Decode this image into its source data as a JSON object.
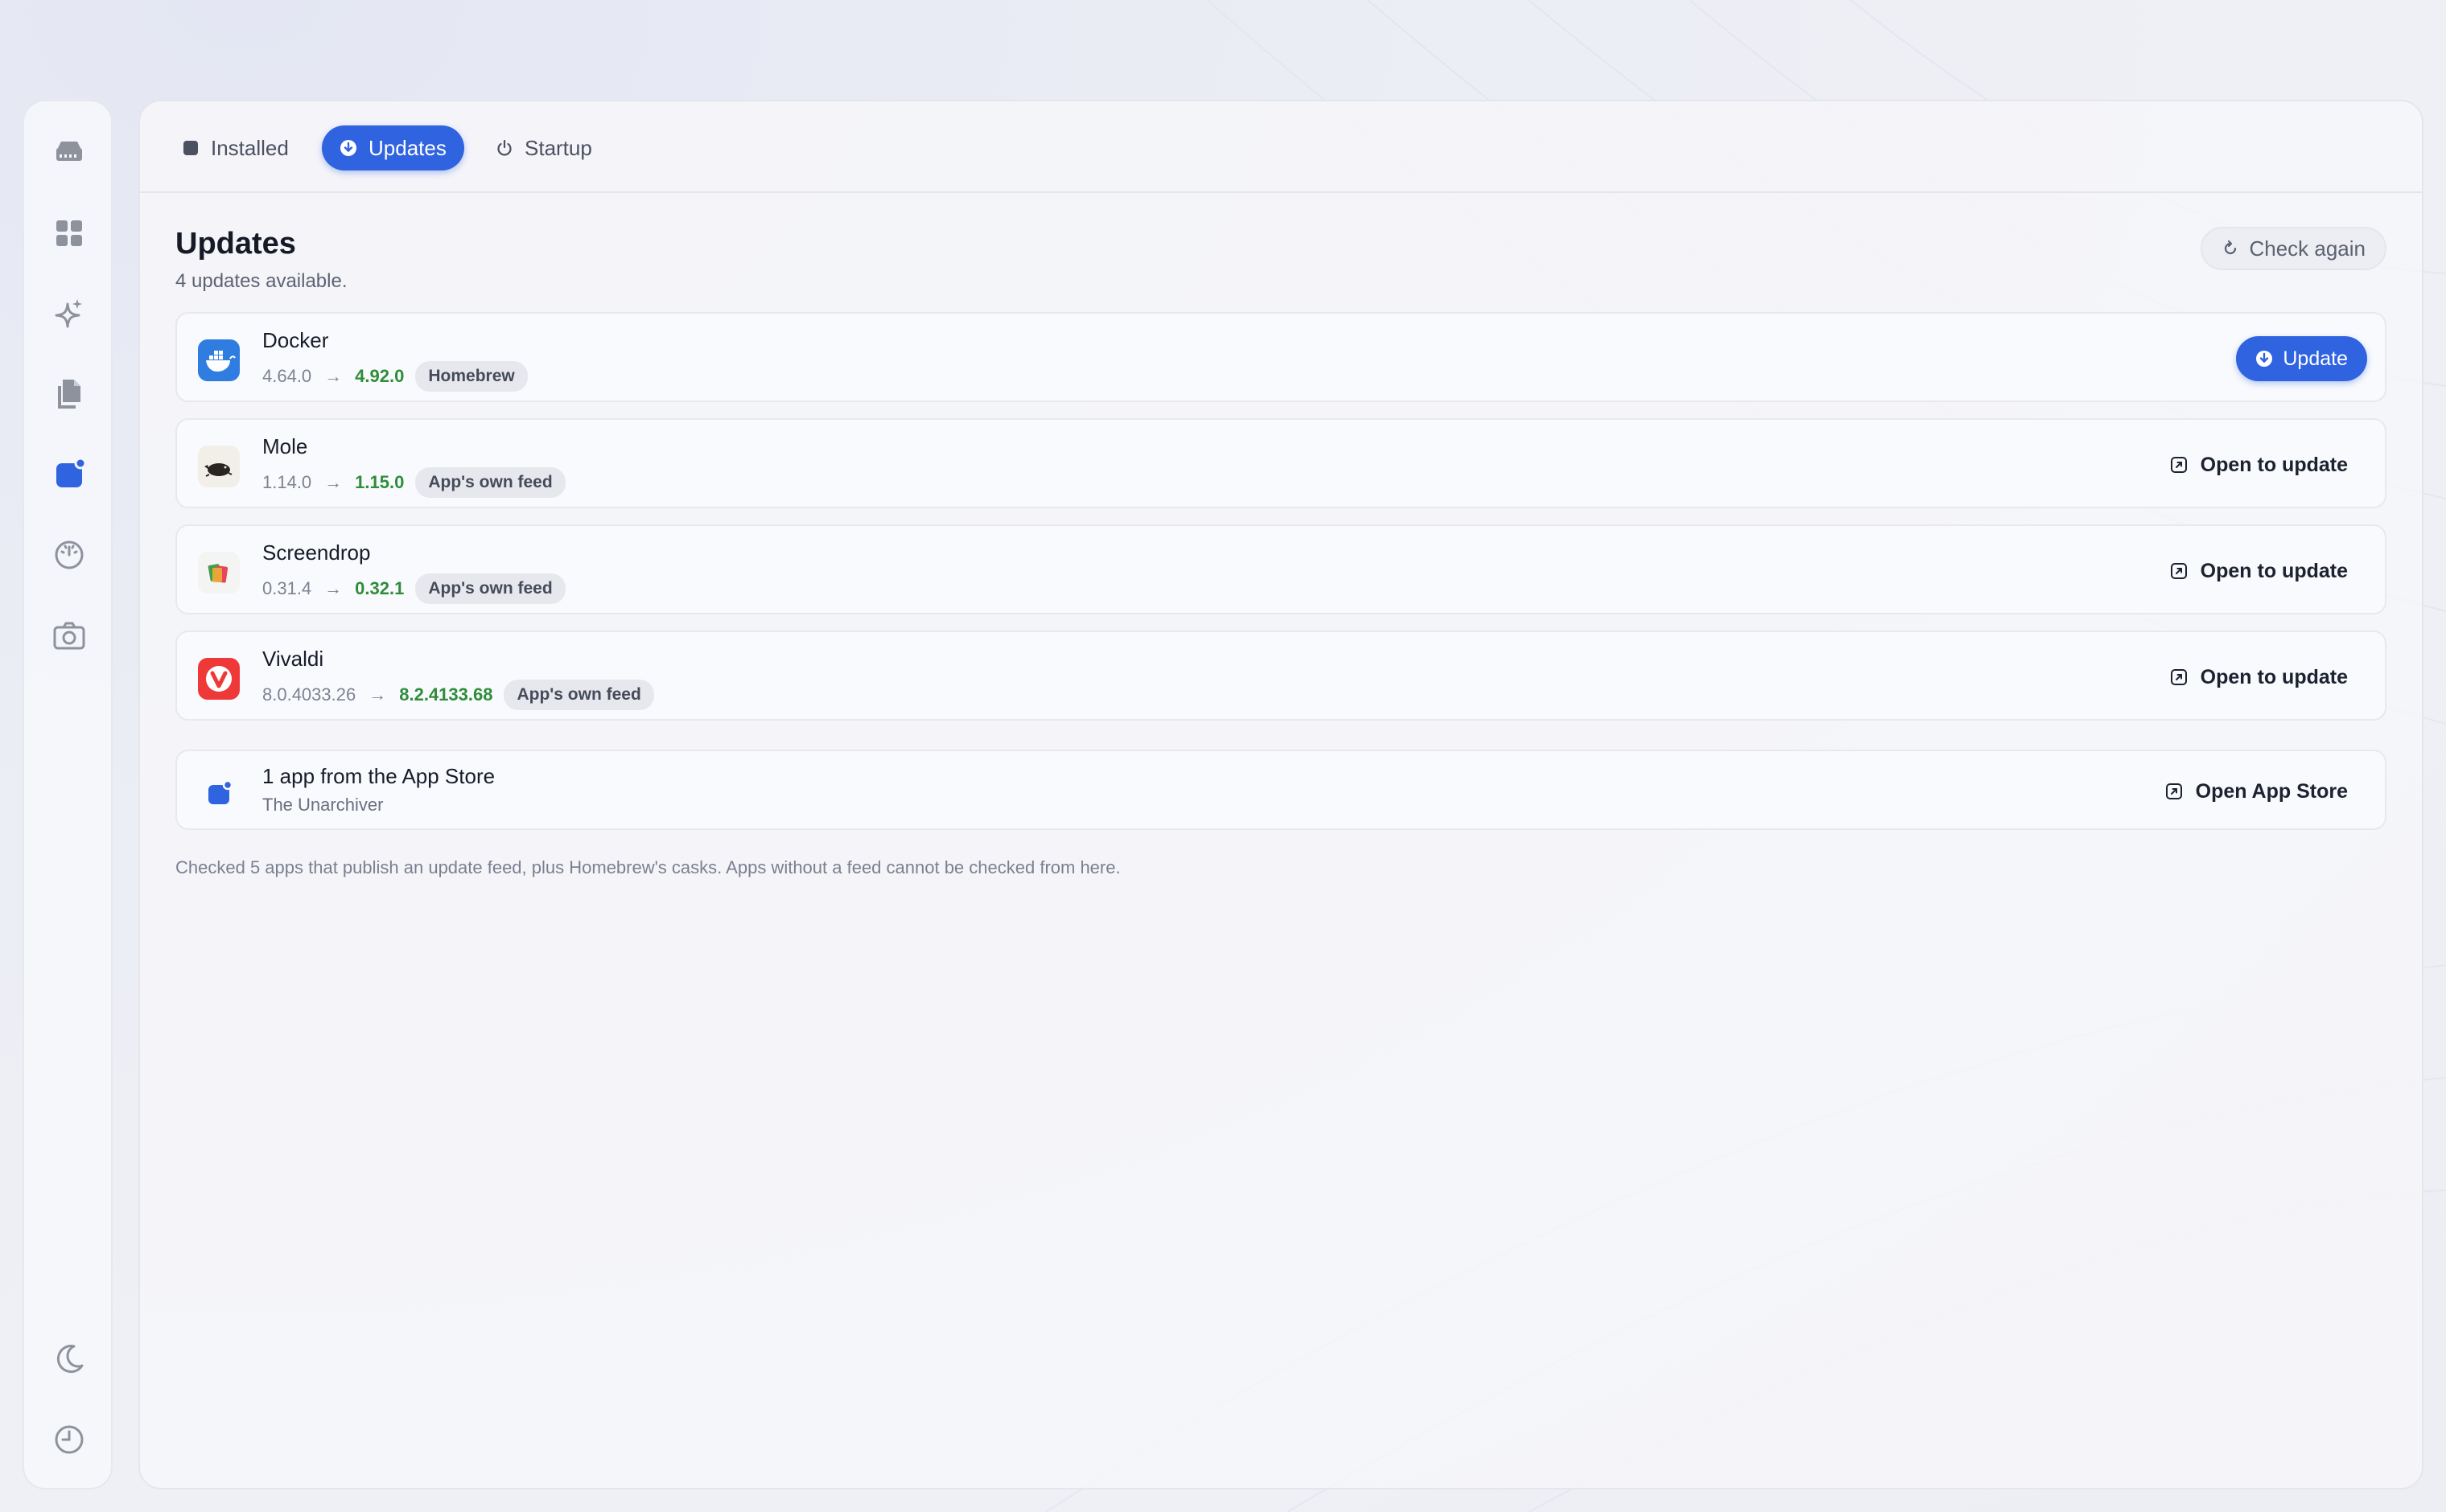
{
  "tabs": [
    {
      "label": "Installed",
      "icon": "square-icon"
    },
    {
      "label": "Updates",
      "icon": "download-circle-icon"
    },
    {
      "label": "Startup",
      "icon": "power-icon"
    }
  ],
  "header": {
    "title": "Updates",
    "subtitle": "4 updates available.",
    "check_label": "Check again"
  },
  "updates": [
    {
      "name": "Docker",
      "old": "4.64.0",
      "arrow": "→",
      "new": "4.92.0",
      "source": "Homebrew",
      "action": "Update"
    },
    {
      "name": "Mole",
      "old": "1.14.0",
      "arrow": "→",
      "new": "1.15.0",
      "source": "App's own feed",
      "action": "Open to update"
    },
    {
      "name": "Screendrop",
      "old": "0.31.4",
      "arrow": "→",
      "new": "0.32.1",
      "source": "App's own feed",
      "action": "Open to update"
    },
    {
      "name": "Vivaldi",
      "old": "8.0.4033.26",
      "arrow": "→",
      "new": "8.2.4133.68",
      "source": "App's own feed",
      "action": "Open to update"
    }
  ],
  "app_store": {
    "title": "1 app from the App Store",
    "subtitle": "The Unarchiver",
    "action": "Open App Store"
  },
  "footer": "Checked 5 apps that publish an update feed, plus Homebrew's casks. Apps without a feed cannot be checked from here.",
  "colors": {
    "accent": "#2f63e0",
    "new_version": "#2e8d3a"
  },
  "sidebar_icons": [
    "disk-icon",
    "grid-icon",
    "sparkle-icon",
    "documents-icon",
    "app-updates-icon",
    "gauge-icon",
    "camera-icon",
    "moon-icon",
    "history-icon"
  ]
}
